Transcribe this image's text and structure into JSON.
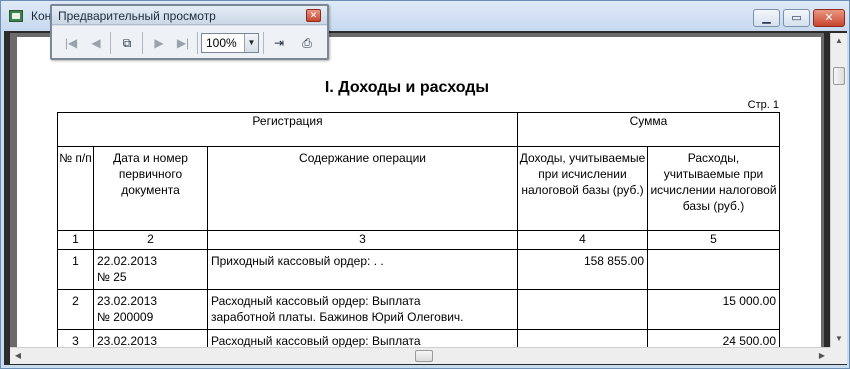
{
  "window": {
    "title": "Кон",
    "minimize_icon": "minimize-icon",
    "maximize_icon": "maximize-icon",
    "close_icon": "close-icon"
  },
  "preview_toolbar": {
    "title": "Предварительный просмотр",
    "zoom_value": "100%",
    "buttons": [
      "first-page",
      "prev-page",
      "copy",
      "next-page",
      "last-page",
      "exit",
      "print"
    ]
  },
  "document": {
    "title": "I. Доходы и расходы",
    "page_label": "Стр. 1",
    "headers": {
      "registration": "Регистрация",
      "sum": "Сумма",
      "num": "№ п/п",
      "date_doc": "Дата и номер первичного документа",
      "content": "Содержание операции",
      "income": "Доходы, учитываемые при исчислении налоговой базы (руб.)",
      "expense": "Расходы, учитываемые при исчислении налоговой базы (руб.)"
    },
    "column_numbers": [
      "1",
      "2",
      "3",
      "4",
      "5"
    ],
    "rows": [
      {
        "num": "1",
        "date": "22.02.2013",
        "doc_no": "№ 25",
        "content_1": "Приходный кассовый ордер: . .",
        "content_2": "",
        "income": "158 855.00",
        "expense": ""
      },
      {
        "num": "2",
        "date": "23.02.2013",
        "doc_no": "№ 200009",
        "content_1": "Расходный кассовый ордер: Выплата",
        "content_2": "заработной платы. Бажинов Юрий Олегович.",
        "income": "",
        "expense": "15 000.00"
      },
      {
        "num": "3",
        "date": "23.02.2013",
        "doc_no": "",
        "content_1": "Расходный кассовый ордер: Выплата",
        "content_2": "",
        "income": "",
        "expense": "24 500.00"
      }
    ]
  }
}
